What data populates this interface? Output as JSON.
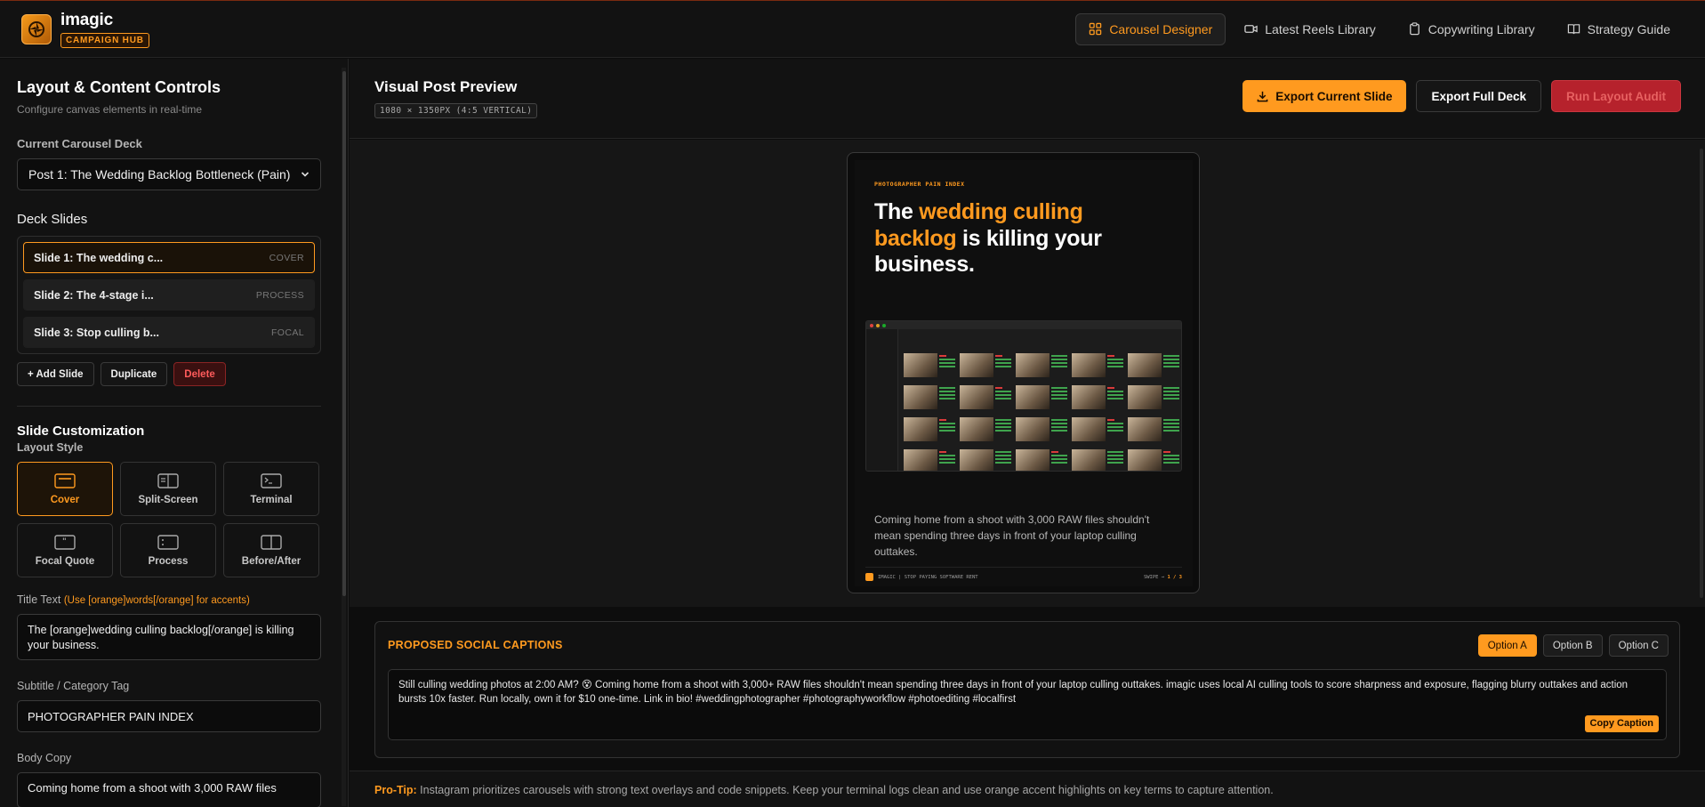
{
  "header": {
    "brand_name": "imagic",
    "brand_badge": "CAMPAIGN HUB",
    "nav": [
      {
        "label": "Carousel Designer",
        "icon": "grid-icon",
        "active": true
      },
      {
        "label": "Latest Reels Library",
        "icon": "video-icon",
        "active": false
      },
      {
        "label": "Copywriting Library",
        "icon": "clipboard-icon",
        "active": false
      },
      {
        "label": "Strategy Guide",
        "icon": "book-icon",
        "active": false
      }
    ]
  },
  "sidebar": {
    "title": "Layout & Content Controls",
    "subtitle": "Configure canvas elements in real-time",
    "deck_label": "Current Carousel Deck",
    "deck_value": "Post 1: The Wedding Backlog Bottleneck (Pain)",
    "slides_label": "Deck Slides",
    "slides": [
      {
        "label": "Slide 1: The wedding c...",
        "tag": "COVER",
        "active": true
      },
      {
        "label": "Slide 2: The 4-stage i...",
        "tag": "PROCESS",
        "active": false
      },
      {
        "label": "Slide 3: Stop culling b...",
        "tag": "FOCAL",
        "active": false
      }
    ],
    "add_slide": "+ Add Slide",
    "duplicate": "Duplicate",
    "delete": "Delete",
    "customization_title": "Slide Customization",
    "layout_style_label": "Layout Style",
    "layouts": [
      {
        "label": "Cover",
        "icon": "cover-layout-icon",
        "active": true
      },
      {
        "label": "Split-Screen",
        "icon": "split-screen-layout-icon",
        "active": false
      },
      {
        "label": "Terminal",
        "icon": "terminal-layout-icon",
        "active": false
      },
      {
        "label": "Focal Quote",
        "icon": "quote-layout-icon",
        "active": false
      },
      {
        "label": "Process",
        "icon": "process-layout-icon",
        "active": false
      },
      {
        "label": "Before/After",
        "icon": "before-after-layout-icon",
        "active": false
      }
    ],
    "title_text_label": "Title Text",
    "title_text_hint": "(Use [orange]words[/orange] for accents)",
    "title_text_value": "The [orange]wedding culling backlog[/orange] is killing your business.",
    "subtitle_label": "Subtitle / Category Tag",
    "subtitle_value": "PHOTOGRAPHER PAIN INDEX",
    "body_label": "Body Copy",
    "body_value": "Coming home from a shoot with 3,000 RAW files"
  },
  "main": {
    "preview_title": "Visual Post Preview",
    "preview_dims": "1080 × 1350PX (4:5 VERTICAL)",
    "export_current": "Export Current Slide",
    "export_full": "Export Full Deck",
    "run_audit": "Run Layout Audit"
  },
  "slide_preview": {
    "tag": "PHOTOGRAPHER PAIN INDEX",
    "title_pre": "The ",
    "title_accent": "wedding culling backlog",
    "title_post": " is killing your business.",
    "body": "Coming home from a shoot with 3,000 RAW files shouldn't mean spending three days in front of your laptop culling outtakes.",
    "footer_left": "IMAGIC | STOP PAYING SOFTWARE RENT",
    "footer_swipe": "SWIPE →",
    "footer_page": "1 / 3"
  },
  "captions": {
    "title": "PROPOSED SOCIAL CAPTIONS",
    "options": [
      {
        "label": "Option A",
        "active": true
      },
      {
        "label": "Option B",
        "active": false
      },
      {
        "label": "Option C",
        "active": false
      }
    ],
    "text": "Still culling wedding photos at 2:00 AM? 😵 Coming home from a shoot with 3,000+ RAW files shouldn't mean spending three days in front of your laptop culling outtakes. imagic uses local AI culling tools to score sharpness and exposure, flagging blurry outtakes and action bursts 10x faster. Run locally, own it for $10 one-time. Link in bio! #weddingphotographer #photographyworkflow #photoediting #localfirst",
    "copy_button": "Copy Caption"
  },
  "protip": {
    "label": "Pro-Tip:",
    "text": " Instagram prioritizes carousels with strong text overlays and code snippets. Keep your terminal logs clean and use orange accent highlights on key terms to capture attention."
  },
  "colors": {
    "accent": "#ff9a1f",
    "danger": "#c8242f",
    "background": "#0d0d0d"
  }
}
